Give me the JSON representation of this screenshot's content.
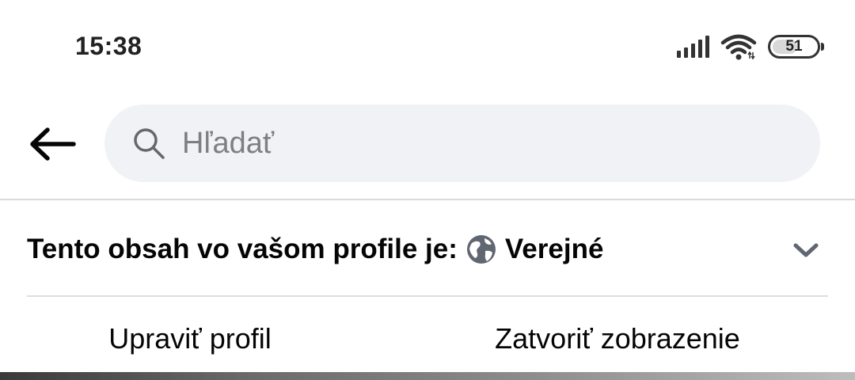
{
  "status_bar": {
    "time": "15:38",
    "battery_level": "51",
    "icons": [
      "signal-icon",
      "wifi-icon",
      "battery-icon"
    ]
  },
  "header": {
    "back_icon": "back-arrow-icon",
    "search_icon": "search-icon",
    "search_placeholder": "Hľadať"
  },
  "privacy": {
    "label": "Tento obsah vo vašom profile je:",
    "icon": "globe-icon",
    "value": "Verejné",
    "dropdown_icon": "chevron-down-icon"
  },
  "actions": {
    "edit_profile": "Upraviť profil",
    "close_view": "Zatvoriť zobrazenie"
  },
  "colors": {
    "search_bg": "#f0f2f5",
    "divider": "#d9dadc",
    "text": "#050505",
    "placeholder": "#7c7f84"
  }
}
